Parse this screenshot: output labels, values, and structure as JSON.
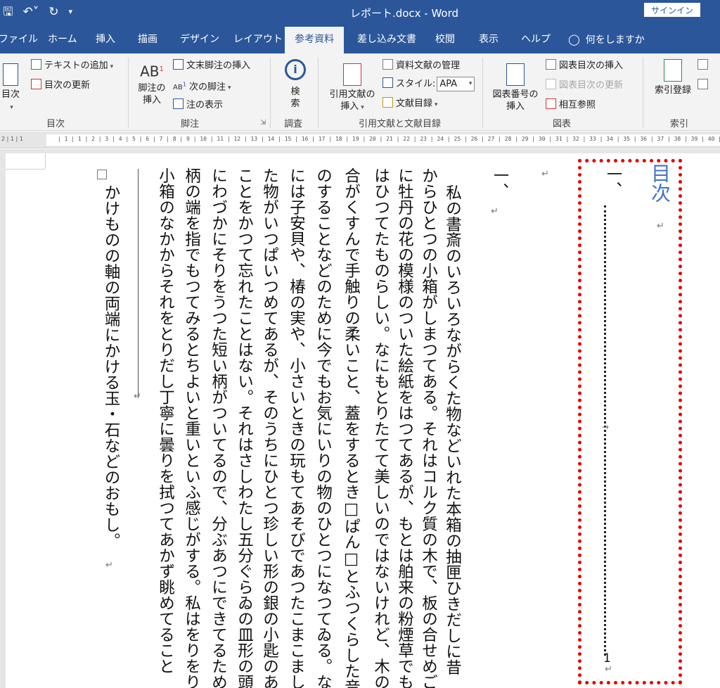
{
  "window": {
    "title": "レポート.docx - Word",
    "signin_label": "サインイン"
  },
  "qat": {
    "save_icon": "save-icon",
    "undo_icon": "undo-icon",
    "redo_icon": "redo-icon",
    "customize_icon": "customize-qat-icon"
  },
  "tabs": [
    {
      "label": "ファイル",
      "active": false
    },
    {
      "label": "ホーム",
      "active": false
    },
    {
      "label": "挿入",
      "active": false
    },
    {
      "label": "描画",
      "active": false
    },
    {
      "label": "デザイン",
      "active": false
    },
    {
      "label": "レイアウト",
      "active": false
    },
    {
      "label": "参考資料",
      "active": true
    },
    {
      "label": "差し込み文書",
      "active": false
    },
    {
      "label": "校閲",
      "active": false
    },
    {
      "label": "表示",
      "active": false
    },
    {
      "label": "ヘルプ",
      "active": false
    },
    {
      "label": "何をしますか",
      "active": false,
      "icon": "lightbulb-icon"
    }
  ],
  "ribbon": {
    "toc_group": {
      "label": "目次",
      "toc_button": "目次",
      "add_text": "テキストの追加",
      "update_toc": "目次の更新"
    },
    "footnotes_group": {
      "label": "脚注",
      "insert_footnote_line1": "脚注の",
      "insert_footnote_line2": "挿入",
      "insert_endnote": "文末脚注の挿入",
      "next_footnote": "次の脚注",
      "show_notes": "注の表示"
    },
    "research_group": {
      "label": "調査",
      "search_line1": "検",
      "search_line2": "索"
    },
    "citations_group": {
      "label": "引用文献と文献目録",
      "insert_citation_line1": "引用文献の",
      "insert_citation_line2": "挿入",
      "manage_sources": "資料文献の管理",
      "style_label": "スタイル:",
      "style_value": "APA",
      "bibliography": "文献目録"
    },
    "captions_group": {
      "label": "図表",
      "insert_caption_line1": "図表番号の",
      "insert_caption_line2": "挿入",
      "insert_table_of_figures": "図表目次の挿入",
      "update_table": "図表目次の更新",
      "cross_reference": "相互参照"
    },
    "index_group": {
      "label": "索引",
      "mark_entry": "索引登録"
    }
  },
  "ruler": {
    "left_marks": "2 | 1 | 1",
    "numbers": "| 1 | 1 | 2 | 3 | 4 | 5 | 6 | 7 | 8 | 9 | 10 | 11 | 12 | 13 | 14 | 15 | 16 | 17 | 18 | 19 | 20 | 21 | 22 | 23 | 24 | 25 | 26 | 27 | 28 | 29 | 30 | 31 | 32 | 33 | 34 | 35 | 36 | 37 | 38 | 39 | 40 | 41"
  },
  "document": {
    "toc_title": "目次",
    "toc_entry": "一、",
    "toc_page": "1",
    "heading": "一、",
    "paragraph_columns": [
      "私の書斎のいろいろながらくた物などいれた本箱の抽匣ひきだしに昔",
      "からひとつの小箱がしまつてある。それはコルク質の木で、板の合せめごと",
      "に牡丹の花の模様のついた絵紙をはつてあるが、もとは舶来の粉煙草でも",
      "はひつてたものらしい。なにもとりたてて美しいのではないけれど、木の色",
      "合がくすんで手触りの柔いこと、蓋をするとき□ぱん□とふつくらした音",
      "のすることなどのために今でもお気にいりの物のひとつになつてゐる。なか",
      "には子安貝や、椿の実や、小さいときの玩もてあそびであつたこまこまし",
      "た物がいつぱいつめてあるが、そのうちにひとつ珍しい形の銀の小匙のある",
      "ことをかつて忘れたことはない。それはさしわたし五分ぐらゐの皿形の頭",
      "にわづかにそりをうつた短い柄がついてるので、分ぶあつにできてるために",
      "柄の端を指でもつてみるとちよいと重いといふ感じがする。私はをりをり",
      "小箱のなかからそれをとりだし丁寧に曇りを拭つてあかず眺めてること"
    ],
    "footnote_text": "かけものの軸の両端にかける玉・石などのおもし。"
  }
}
